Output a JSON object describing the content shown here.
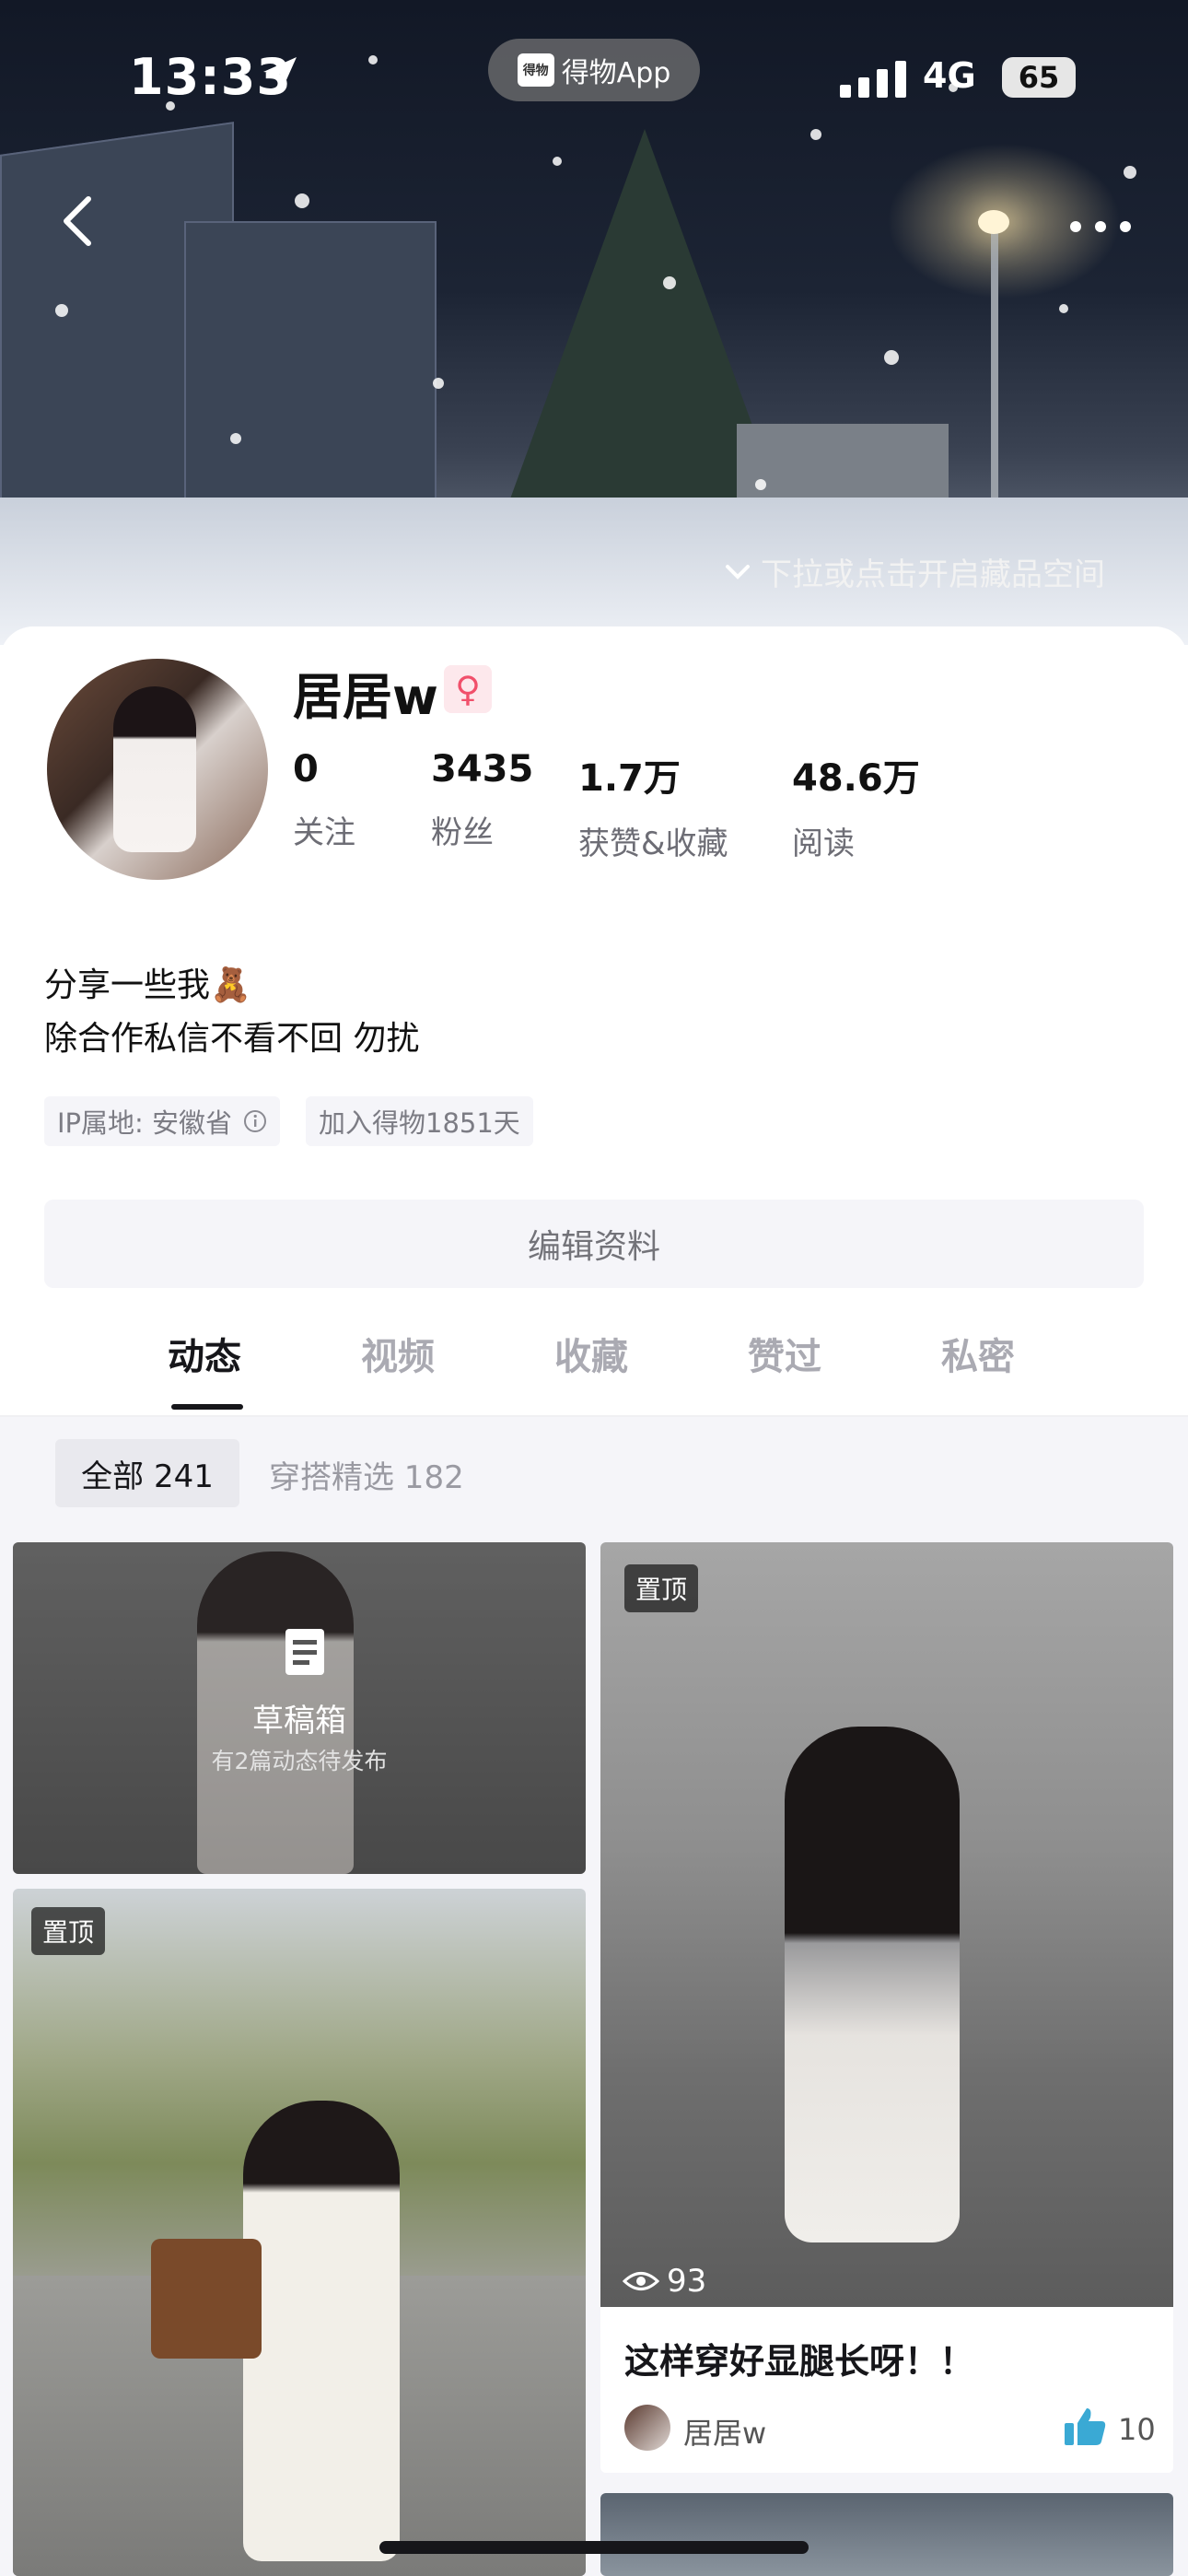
{
  "status_bar": {
    "time": "13:33",
    "app_name": "得物App",
    "network": "4G",
    "battery": "65"
  },
  "header": {
    "collection_hint": "下拉或点击开启藏品空间"
  },
  "profile": {
    "username": "居居w",
    "gender_symbol": "♀",
    "stats": [
      {
        "value": "0",
        "label": "关注"
      },
      {
        "value": "3435",
        "label": "粉丝"
      },
      {
        "value": "1.7万",
        "label": "获赞&收藏"
      },
      {
        "value": "48.6万",
        "label": "阅读"
      }
    ],
    "bio_line1": "分享一些我🧸",
    "bio_line2": "除合作私信不看不回 勿扰",
    "ip_tag": "IP属地: 安徽省",
    "join_tag": "加入得物1851天",
    "edit_button": "编辑资料"
  },
  "tabs": [
    "动态",
    "视频",
    "收藏",
    "赞过",
    "私密"
  ],
  "filters": {
    "all": "全部 241",
    "outfit": "穿搭精选 182"
  },
  "feed": {
    "draft": {
      "title": "草稿箱",
      "subtitle": "有2篇动态待发布"
    },
    "pinned_label": "置顶",
    "post_right": {
      "views": "93",
      "title": "这样穿好显腿长呀！！",
      "author": "居居w",
      "likes": "10"
    }
  },
  "colors": {
    "accent_female": "#f1506b",
    "like_blue": "#3aa9d4"
  }
}
